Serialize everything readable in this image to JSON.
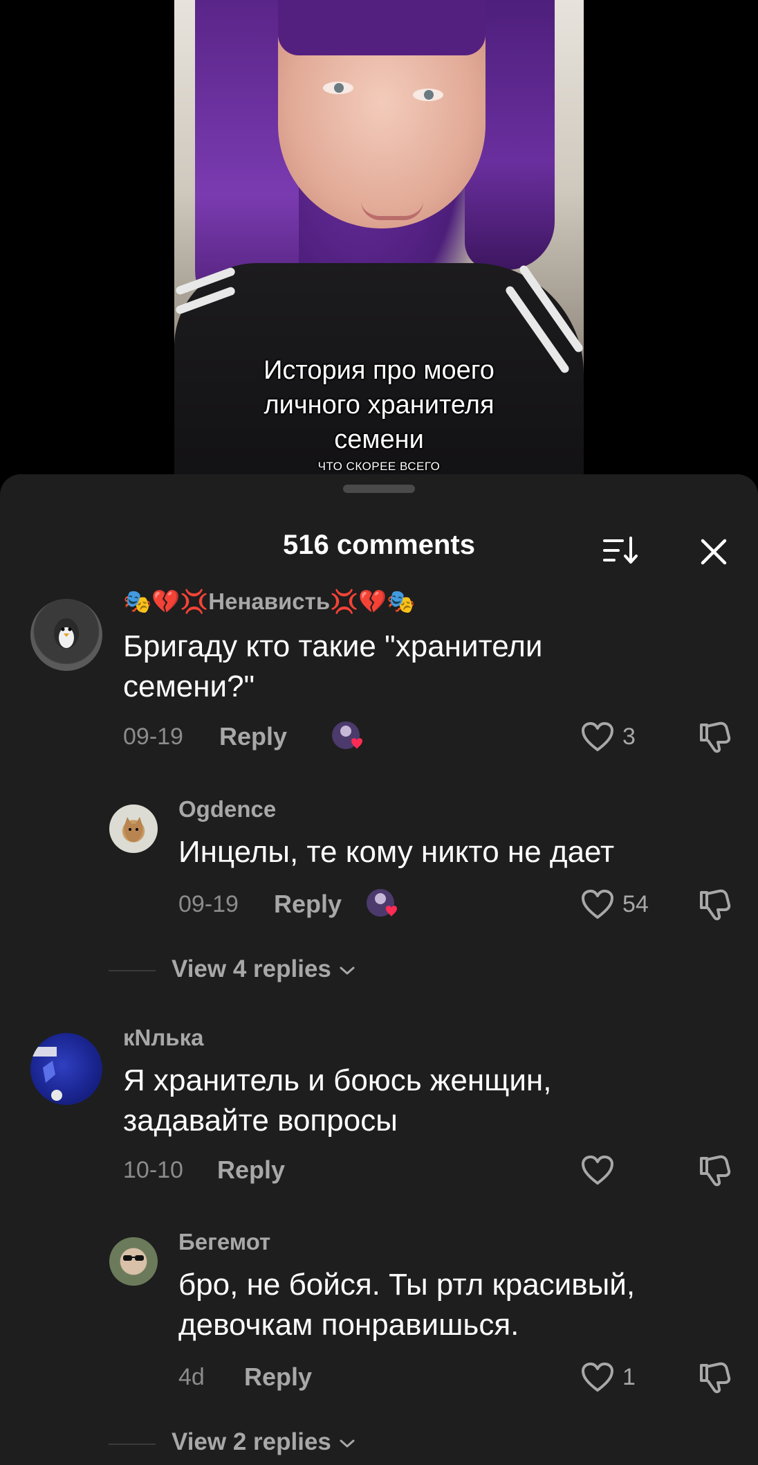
{
  "video": {
    "caption_main_1": "История про моего",
    "caption_main_2": "личного хранителя",
    "caption_main_3": "семени",
    "caption_sub": "ЧТО СКОРЕЕ ВСЕГО"
  },
  "sheet": {
    "title": "516 comments",
    "sort_icon": "sort-icon",
    "close_icon": "close-icon"
  },
  "comments": [
    {
      "username": "🎭💔💢Ненависть💢💔🎭",
      "text_1": "Бригаду кто такие \"хранители",
      "text_2": "семени?\"",
      "date": "09-19",
      "reply": "Reply",
      "likes": "3"
    },
    {
      "username": "Ogdence",
      "text_1": "Инцелы, те кому никто не дает",
      "date": "09-19",
      "reply": "Reply",
      "likes": "54",
      "view_replies": "View 4 replies"
    },
    {
      "username": "кNлька",
      "text_1": "Я хранитель и боюсь женщин,",
      "text_2": "задавайте вопросы",
      "date": "10-10",
      "reply": "Reply",
      "likes": ""
    },
    {
      "username": "Бегемот",
      "text_1": "бро, не бойся. Ты ртл красивый,",
      "text_2": "девочкам понравишься.",
      "date": "4d",
      "reply": "Reply",
      "likes": "1",
      "view_replies": "View 2 replies"
    }
  ],
  "colors": {
    "sheet_bg": "#1e1e1e",
    "like_badge": "#fe2c55"
  }
}
